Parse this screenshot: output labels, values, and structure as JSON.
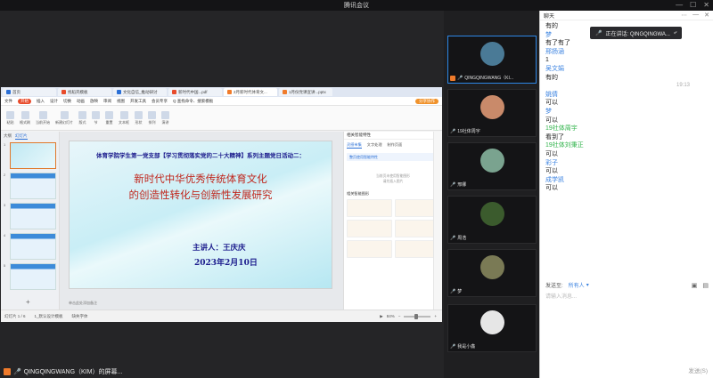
{
  "meeting": {
    "window_title": "腾讯会议",
    "presenter_label": "QINGQINGWANG（KIM）的屏幕..."
  },
  "wps": {
    "tabs": [
      {
        "label": "首页",
        "color": "#2a6fd6"
      },
      {
        "label": "找稻壳模板",
        "color": "#e84b2b"
      },
      {
        "label": "文化自信_推动研讨",
        "color": "#2a6fd6"
      },
      {
        "label": "新时代中国...pdf",
        "color": "#e84b2b"
      },
      {
        "label": "2月新时代体育文...",
        "color": "#f07b2b"
      },
      {
        "label": "1月份党课宣讲...pptx",
        "color": "#f07b2b"
      }
    ],
    "menu": [
      "文件",
      "开始",
      "插入",
      "设计",
      "切换",
      "动画",
      "放映",
      "审阅",
      "视图",
      "开发工具",
      "会员专享",
      "Q 查找命令、搜索模板"
    ],
    "menu_start_label": "开始",
    "collab_label": "分享协作",
    "ribbon": [
      "粘贴",
      "格式刷",
      "当前开始",
      "新建幻灯片",
      "版式",
      "节",
      "重置",
      "文本框",
      "形状",
      "排列",
      "演讲"
    ],
    "thumb_tabs": [
      "大纲",
      "幻灯片"
    ],
    "thumb_numbers": [
      "1",
      "2",
      "3",
      "4",
      "5"
    ],
    "slide": {
      "top_line": "体育学院学生第一党支部【学习贯彻落实党的二十大精神】系列主题党日活动二：",
      "title_line1": "新时代中华优秀传统体育文化",
      "title_line2": "的创造性转化与创新性发展研究",
      "speaker": "主讲人：王庆庆",
      "date": "2023年2月10日"
    },
    "notes_placeholder": "单击此处添加备注",
    "side_panel": {
      "title": "相关智能特性",
      "tabs": [
        "灵感市集",
        "文字处理",
        "制作页面"
      ],
      "banner": "整页使用智能特性",
      "middle_text": "当前页未使用智能图形\n请先插入图片",
      "section": "相关智能图形"
    },
    "status": {
      "page": "幻灯片 1 / 6",
      "theme": "1_默认设计模板",
      "missing_font": "缺失字体",
      "zoom": "84%"
    }
  },
  "videos": [
    {
      "name": "QINGQINGWANG（KI...",
      "avatar_color": "#4a7a96",
      "active": true
    },
    {
      "name": "19社体周宇",
      "avatar_color": "#c98a6a",
      "active": false
    },
    {
      "name": "邢娜",
      "avatar_color": "#7aa38f",
      "active": false
    },
    {
      "name": "周浩",
      "avatar_color": "#3b5b2d",
      "active": false
    },
    {
      "name": "梦",
      "avatar_color": "#7a7a55",
      "active": false
    },
    {
      "name": "我是小鑫",
      "avatar_color": "#e6e6e6",
      "active": false
    }
  ],
  "chat": {
    "title": "聊天",
    "speaking_label": "正在讲话: QINGQINGWA...",
    "messages": [
      {
        "text": "有的",
        "type": "plain"
      },
      {
        "text": "梦",
        "type": "name"
      },
      {
        "text": "有了有了",
        "type": "plain"
      },
      {
        "text": "邢扬涵",
        "type": "name"
      },
      {
        "text": "1",
        "type": "plain"
      },
      {
        "text": "吴文娟",
        "type": "name"
      },
      {
        "text": "有的",
        "type": "plain"
      },
      {
        "text": "19:13",
        "type": "time"
      },
      {
        "text": "姚倩",
        "type": "name"
      },
      {
        "text": "可以",
        "type": "plain"
      },
      {
        "text": "梦",
        "type": "name"
      },
      {
        "text": "可以",
        "type": "plain"
      },
      {
        "text": "19社体周宇",
        "type": "green"
      },
      {
        "text": "看到了",
        "type": "plain"
      },
      {
        "text": "19社体刘秉正",
        "type": "green"
      },
      {
        "text": "可以",
        "type": "plain"
      },
      {
        "text": "彩子",
        "type": "name"
      },
      {
        "text": "可以",
        "type": "plain"
      },
      {
        "text": "成学凯",
        "type": "name"
      },
      {
        "text": "可以",
        "type": "plain"
      }
    ],
    "send_to_label": "发送至:",
    "send_target": "所有人",
    "input_placeholder": "请输入消息...",
    "send_button": "发送(S)"
  }
}
